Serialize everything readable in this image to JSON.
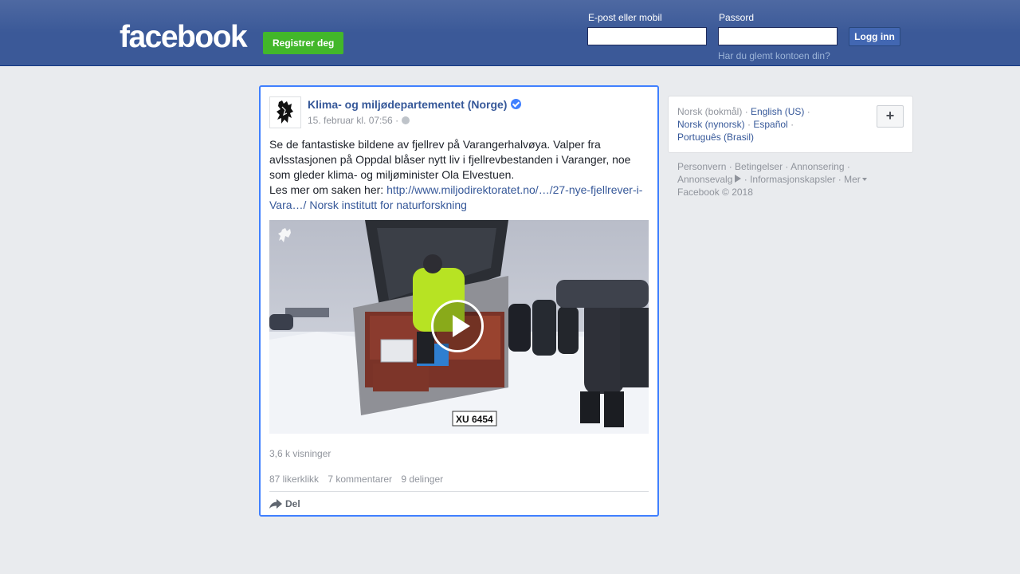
{
  "header": {
    "logo_text": "facebook",
    "register_label": "Registrer deg",
    "email_label": "E-post eller mobil",
    "password_label": "Passord",
    "email_value": "",
    "password_value": "",
    "login_label": "Logg inn",
    "forgot_link": "Har du glemt kontoen din?"
  },
  "post": {
    "page_name": "Klima- og miljødepartementet (Norge)",
    "timestamp": "15. februar kl. 07:56 ·",
    "text_line1": "Se de fantastiske bildene av fjellrev på Varangerhalvøya. Valper fra avlsstasjonen på Oppdal blåser nytt liv i fjellrevbestanden i Varanger, noe som gleder klima- og miljøminister Ola Elvestuen.",
    "text_prefix": "Les mer om saken her: ",
    "link_text": "http://www.miljodirektoratet.no/…/27-nye-fjellrever-i-Vara…/",
    "link_text2": "Norsk institutt for naturforskning",
    "truck_plate": "XU 6454",
    "views": "3,6 k visninger",
    "likes": "87 likerklikk",
    "comments": "7 kommentarer",
    "shares": "9 delinger",
    "share_label": "Del",
    "icons": {
      "verified": "verified-badge-icon",
      "globe": "public-globe-icon",
      "play": "play-icon",
      "share": "share-arrow-icon"
    }
  },
  "languages": {
    "current": "Norsk (bokmål)",
    "options": [
      "English (US)",
      "Norsk (nynorsk)",
      "Español",
      "Português (Brasil)"
    ],
    "add_label": "+"
  },
  "footer": {
    "links": [
      "Personvern",
      "Betingelser",
      "Annonsering",
      "Annonsevalg",
      "Informasjonskapsler",
      "Mer"
    ],
    "copyright": "Facebook © 2018"
  },
  "colors": {
    "brand_blue": "#3b5998",
    "register_green": "#42b72a",
    "link_blue": "#365899",
    "focus_border": "#4080ff"
  }
}
